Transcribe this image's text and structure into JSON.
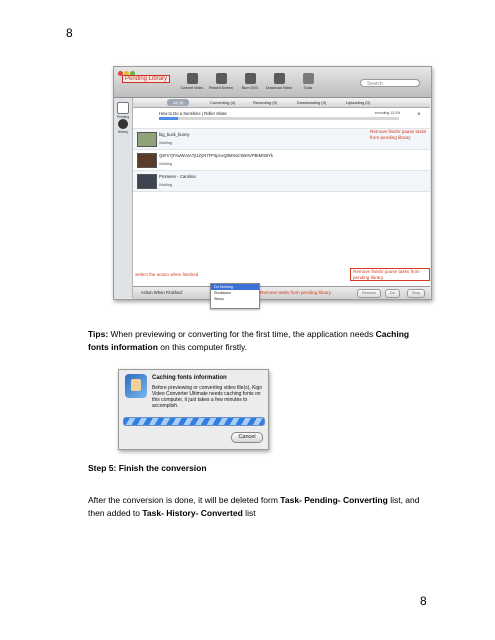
{
  "page_number": "8",
  "screenshot": {
    "pending_library": "Pending Library",
    "toolbar": [
      "Convert Video",
      "Record Screen",
      "Burn DVD",
      "Download Video",
      "Tools"
    ],
    "search_placeholder": "Search",
    "sidebar": [
      "Pending",
      "History"
    ],
    "tabs": [
      "All (5)",
      "Converting (4)",
      "Recording (0)",
      "Downloading (0)",
      "Uploading (0)"
    ],
    "rows": [
      {
        "title": "How to Do a Sunshine | Roller Skate",
        "status": "",
        "pct": "encoding 13.2%",
        "progress": 0.08
      },
      {
        "title": "big_buck_bunny",
        "status": "Waiting"
      },
      {
        "title": "QsFn7jTAwWvVA7jI1ZyN7FP3pAxQ0MVoC5WAVPBIMGBYk",
        "status": "Waiting"
      },
      {
        "title": "Prometer - Carolina",
        "status": "Waiting"
      }
    ],
    "note_remove": "Remove finish/ pause tasks from pending library",
    "note_remove2": "Remove finish/ pause tasks from pending library",
    "note_select": "Select the action when finished",
    "note_remove_tasks": "Remove tasks from pending library",
    "action_label": "Action When Finished:",
    "dropdown_options": [
      "Do Nothing",
      "Shutdown",
      "Sleep"
    ],
    "buttons": [
      "Remove",
      "Do",
      "Stop"
    ]
  },
  "tips": {
    "prefix": "Tips:",
    "text1": " When previewing or converting for the first time, the application needs ",
    "bold1": "Caching fonts information",
    "text2": " on this computer firstly."
  },
  "dialog": {
    "title": "Caching fonts information",
    "body": "Before previewing or converting video file(s), Kigo Video Converter Ultimate needs caching fonts on this computer, it just takes a few minutes to accomplish.",
    "cancel": "Cancel"
  },
  "step": {
    "heading": "Step 5: Finish the conversion",
    "text1": "After the conversion is done, it will be deleted form ",
    "bold1": "Task- Pending- Converting",
    "text2": " list, and then added to ",
    "bold2": "Task- History- Converted",
    "text3": " list"
  }
}
